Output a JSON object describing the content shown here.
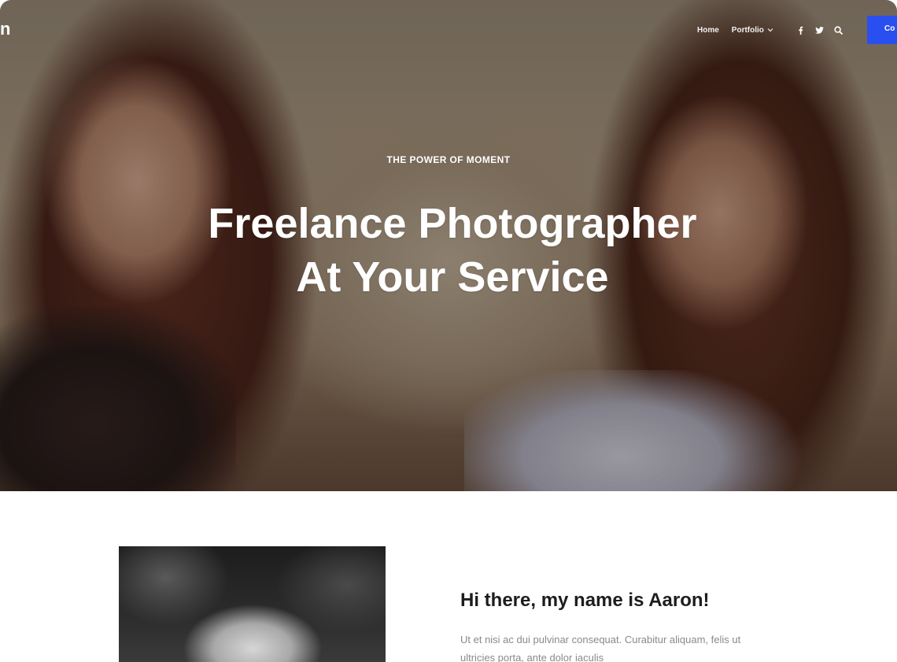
{
  "header": {
    "logo_text": "n",
    "nav": [
      {
        "label": "Home"
      },
      {
        "label": "Portfolio"
      }
    ],
    "social_icons": [
      "facebook-icon",
      "twitter-icon",
      "search-icon"
    ],
    "cta_label": "Co"
  },
  "hero": {
    "eyebrow": "THE POWER OF MOMENT",
    "headline_line1": "Freelance Photographer",
    "headline_line2": "At Your Service"
  },
  "about": {
    "title": "Hi there, my name is Aaron!",
    "text": "Ut et nisi ac dui pulvinar consequat. Curabitur aliquam, felis ut ultricies porta, ante dolor iaculis"
  },
  "colors": {
    "accent": "#2a4ff0",
    "title": "#1d1d1f",
    "body_text": "#8a8a8a"
  }
}
